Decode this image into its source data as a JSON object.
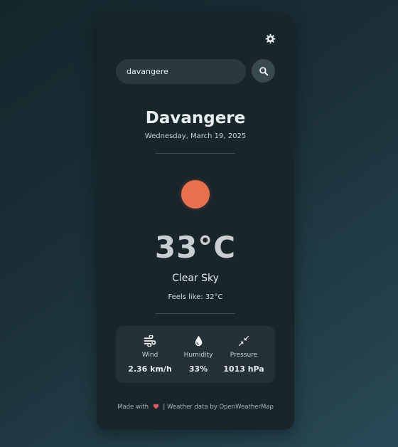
{
  "search": {
    "value": "davangere",
    "placeholder": ""
  },
  "location": {
    "city": "Davangere",
    "date": "Wednesday, March 19, 2025"
  },
  "weather": {
    "icon": "sun-icon",
    "temperature": "33°C",
    "condition": "Clear Sky",
    "feels_like": "Feels like: 32°C"
  },
  "stats": [
    {
      "icon": "wind-icon",
      "label": "Wind",
      "value": "2.36 km/h"
    },
    {
      "icon": "water-drop-icon",
      "label": "Humidity",
      "value": "33%"
    },
    {
      "icon": "compress-arrows-icon",
      "label": "Pressure",
      "value": "1013 hPa"
    }
  ],
  "footer": {
    "made_with": "Made with",
    "credits": "| Weather data by OpenWeatherMap"
  },
  "colors": {
    "accent_sun": "#e8704c",
    "heart": "#e05a64",
    "card_bg": "#18262b"
  },
  "icons": {
    "settings": "gear-icon",
    "search": "search-icon",
    "heart": "heart-icon"
  }
}
